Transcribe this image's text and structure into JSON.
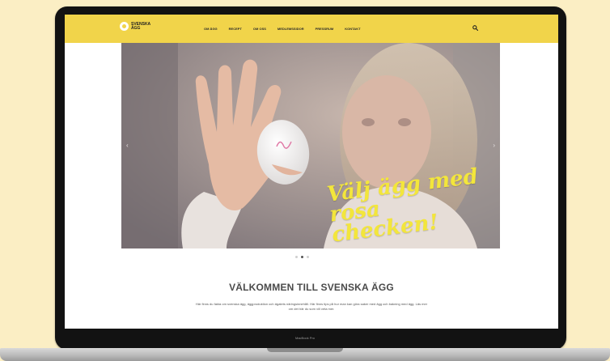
{
  "nav": {
    "logo_text": "SVENSKA ÄGG",
    "items": [
      {
        "label": "OM ÄGG"
      },
      {
        "label": "RECEPT"
      },
      {
        "label": "OM OSS"
      },
      {
        "label": "MEDLEMSSIDOR"
      },
      {
        "label": "PRESSRUM"
      },
      {
        "label": "KONTAKT"
      }
    ],
    "search_icon": "search-icon"
  },
  "hero": {
    "slogan_line1": "Välj ägg med",
    "slogan_line2": "rosa checken!",
    "egg_mark": "rosa check",
    "dots_active": 2,
    "dots_total": 3
  },
  "welcome": {
    "heading": "VÄLKOMMEN TILL SVENSKA ÄGG",
    "intro": "Här finns du fakta om svenska ägg, äggproduktion och ägatets näringsinnehåll. Här finns tips på hur man kan göra saker med ägg och bakning med ägg. Läs mer om det här du som vill veta mer."
  },
  "device": {
    "model": "MacBook Pro"
  },
  "colors": {
    "background": "#fbeec4",
    "nav_bg": "#f1d44a",
    "slogan": "#f3e63b"
  }
}
